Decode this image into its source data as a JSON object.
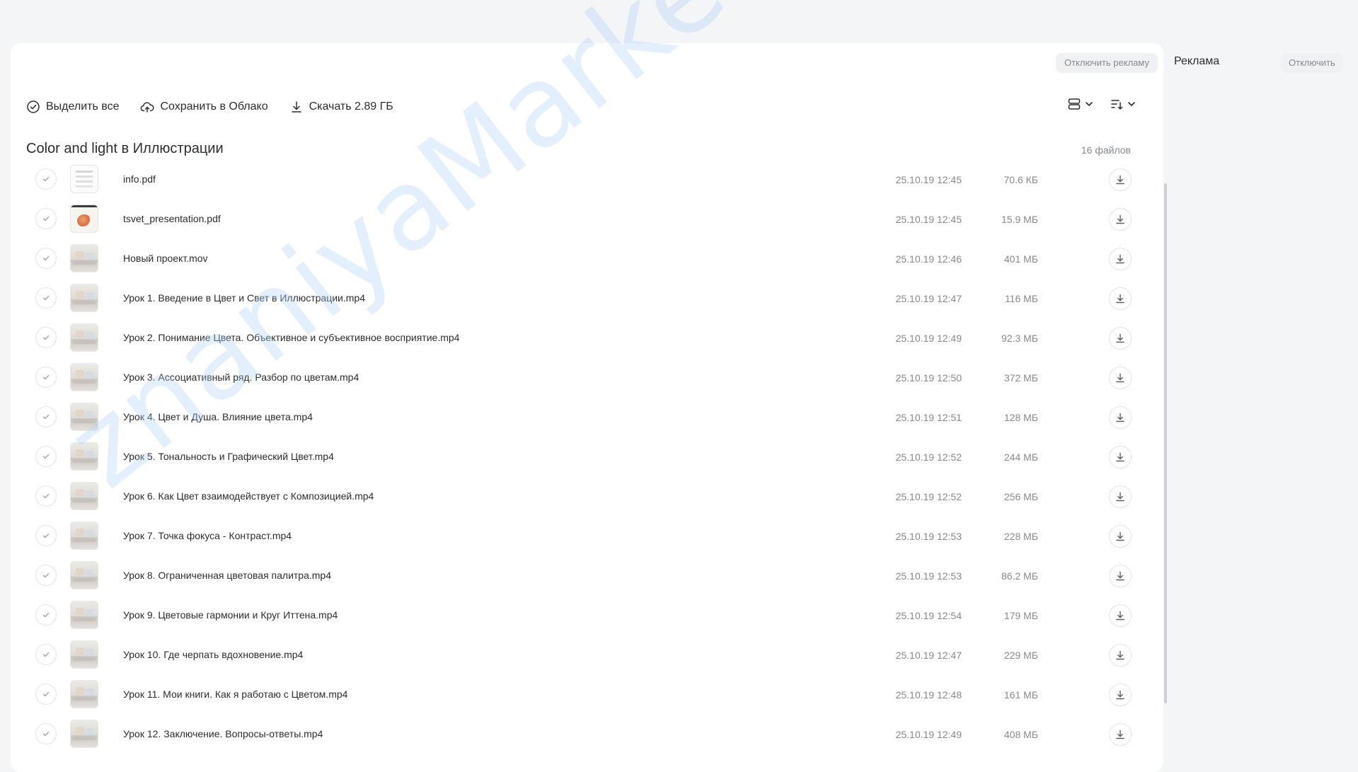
{
  "header": {
    "disable_ads_label": "Отключить рекламу"
  },
  "toolbar": {
    "select_all_label": "Выделить все",
    "save_to_cloud_label": "Сохранить в Облако",
    "download_label": "Скачать 2.89 ГБ"
  },
  "folder": {
    "title": "Color and light в Иллюстрации",
    "count": "16 файлов"
  },
  "files": [
    {
      "name": "info.pdf",
      "date": "25.10.19 12:45",
      "size": "70.6 КБ",
      "thumb": "pdf"
    },
    {
      "name": "tsvet_presentation.pdf",
      "date": "25.10.19 12:45",
      "size": "15.9 МБ",
      "thumb": "pres"
    },
    {
      "name": "Новый проект.mov",
      "date": "25.10.19 12:46",
      "size": "401 МБ",
      "thumb": "vid"
    },
    {
      "name": "Урок 1. Введение в Цвет и Свет в Иллюстрации.mp4",
      "date": "25.10.19 12:47",
      "size": "116 МБ",
      "thumb": "vid"
    },
    {
      "name": "Урок 2. Понимание Цвета. Объективное и субъективное восприятие.mp4",
      "date": "25.10.19 12:49",
      "size": "92.3 МБ",
      "thumb": "vid"
    },
    {
      "name": "Урок 3. Ассоциативный ряд. Разбор по цветам.mp4",
      "date": "25.10.19 12:50",
      "size": "372 МБ",
      "thumb": "vid"
    },
    {
      "name": "Урок 4. Цвет и Душа. Влияние цвета.mp4",
      "date": "25.10.19 12:51",
      "size": "128 МБ",
      "thumb": "vid"
    },
    {
      "name": "Урок 5. Тональность и Графический Цвет.mp4",
      "date": "25.10.19 12:52",
      "size": "244 МБ",
      "thumb": "vid"
    },
    {
      "name": "Урок 6. Как Цвет взаимодействует с Композицией.mp4",
      "date": "25.10.19 12:52",
      "size": "256 МБ",
      "thumb": "vid"
    },
    {
      "name": "Урок 7. Точка фокуса - Контраст.mp4",
      "date": "25.10.19 12:53",
      "size": "228 МБ",
      "thumb": "vid"
    },
    {
      "name": "Урок 8. Ограниченная цветовая палитра.mp4",
      "date": "25.10.19 12:53",
      "size": "86.2 МБ",
      "thumb": "vid"
    },
    {
      "name": "Урок 9. Цветовые гармонии и Круг Иттена.mp4",
      "date": "25.10.19 12:54",
      "size": "179 МБ",
      "thumb": "vid"
    },
    {
      "name": "Урок 10. Где черпать вдохновение.mp4",
      "date": "25.10.19 12:47",
      "size": "229 МБ",
      "thumb": "vid"
    },
    {
      "name": "Урок 11. Мои книги. Как я работаю с Цветом.mp4",
      "date": "25.10.19 12:48",
      "size": "161 МБ",
      "thumb": "vid"
    },
    {
      "name": "Урок 12. Заключение. Вопросы-ответы.mp4",
      "date": "25.10.19 12:49",
      "size": "408 МБ",
      "thumb": "vid"
    }
  ],
  "ad_panel": {
    "title": "Реклама",
    "disable_label": "Отключить"
  },
  "watermark": "znaniyaMarket.club"
}
